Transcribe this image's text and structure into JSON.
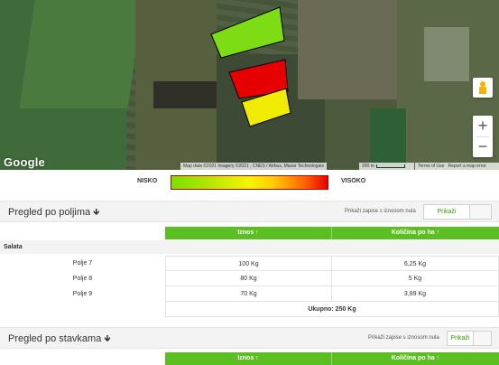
{
  "map": {
    "google_logo": "Google",
    "attribution": "Map data ©2021 Imagery ©2021 , CNES / Airbus, Maxar Technologies",
    "scale_label": "200 m",
    "terms": "Terms of Use",
    "report": "Report a map error",
    "zoom_in": "+",
    "zoom_out": "−",
    "field_colors": [
      "#7ddc14",
      "#e60000",
      "#f0eb00"
    ]
  },
  "legend": {
    "low_label": "NISKO",
    "high_label": "VISOKO"
  },
  "section_fields": {
    "title": "Pregled po poljima",
    "sort_icon": "arrow-down-icon",
    "zero_label": "Prikaži zapise s iznosom nula",
    "show_label": "Prikaži",
    "columns": [
      "Iznos ↑",
      "Količina po ha ↑"
    ],
    "group": "Salata",
    "rows": [
      {
        "name": "Polje 7",
        "amount": "100 Kg",
        "per_ha": "6,25 Kg"
      },
      {
        "name": "Polje 8",
        "amount": "80 Kg",
        "per_ha": "5 Kg"
      },
      {
        "name": "Polje 9",
        "amount": "70 Kg",
        "per_ha": "3,89 Kg"
      }
    ],
    "total": "Ukupno: 250 Kg"
  },
  "section_items": {
    "title": "Pregled po stavkama",
    "sort_icon": "arrow-down-icon",
    "zero_label": "Prikaži zapise s iznosom nula",
    "show_label": "Prikaži",
    "columns": [
      "Iznos ↑",
      "Količina po ha ↑"
    ]
  }
}
